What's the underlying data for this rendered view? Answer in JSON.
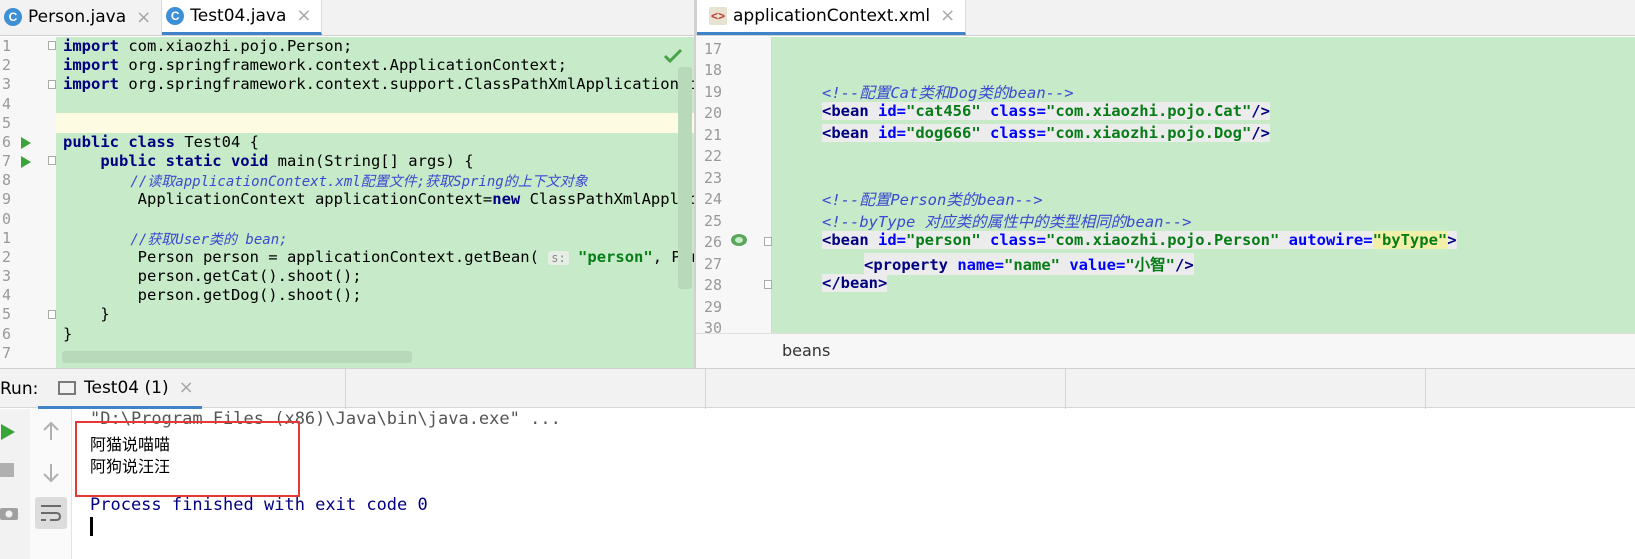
{
  "left_tabs": [
    {
      "label": "Person.java",
      "icon": "C",
      "active": false
    },
    {
      "label": "Test04.java",
      "icon": "C",
      "active": true
    }
  ],
  "right_tabs": [
    {
      "label": "applicationContext.xml",
      "icon": "xml",
      "active": true
    }
  ],
  "java_editor": {
    "line_numbers": [
      "1",
      "2",
      "3",
      "4",
      "5",
      "6",
      "7",
      "8",
      "9",
      "0",
      "1",
      "2",
      "3",
      "4",
      "5",
      "6",
      "7"
    ],
    "imports": [
      [
        "import",
        " com.xiaozhi.pojo.Person;"
      ],
      [
        "import",
        " org.springframework.context.ApplicationContext;"
      ],
      [
        "import",
        " org.springframework.context.support.ClassPathXmlApplicationContext"
      ]
    ],
    "class_kw1": "public",
    "class_kw2": " class",
    "class_rest": " Test04 {",
    "main_kw": "    public static void",
    "main_rest": " main(String[] args) {",
    "comment1": "        //读取applicationContext.xml配置文件;获取Spring的上下文对象",
    "line9a": "        ApplicationContext applicationContext=",
    "line9kw": "new",
    "line9b": " ClassPathXmlApplication",
    "comment2": "        //获取User类的 bean;",
    "line12a": "        Person person = applicationContext.getBean( ",
    "line12hint": "s:",
    "line12str": " \"person\"",
    "line12b": ", Person.cl",
    "line13": "        person.getCat().shoot();",
    "line14": "        person.getDog().shoot();",
    "line15": "    }",
    "line16": "}"
  },
  "xml_editor": {
    "line_numbers": [
      "17",
      "18",
      "19",
      "20",
      "21",
      "22",
      "23",
      "24",
      "25",
      "26",
      "27",
      "28",
      "29",
      "30"
    ],
    "comment1": "<!--配置Cat类和Dog类的bean-->",
    "bean_cat": {
      "tag": "<bean",
      "id_attr": " id=",
      "id_val": "\"cat456\"",
      "class_attr": " class=",
      "class_val": "\"com.xiaozhi.pojo.Cat\"",
      "end": "/>"
    },
    "bean_dog": {
      "tag": "<bean",
      "id_attr": " id=",
      "id_val": "\"dog666\"",
      "class_attr": " class=",
      "class_val": "\"com.xiaozhi.pojo.Dog\"",
      "end": "/>"
    },
    "comment2": "<!--配置Person类的bean-->",
    "comment3": "<!--byType 对应类的属性中的类型相同的bean-->",
    "bean_person": {
      "tag": "<bean",
      "id_attr": " id=",
      "id_val": "\"person\"",
      "class_attr": " class=",
      "class_val": "\"com.xiaozhi.pojo.Person\"",
      "autowire_attr": " autowire=",
      "autowire_val": "\"byType\"",
      "end": ">"
    },
    "property": {
      "tag": "<property",
      "name_attr": " name=",
      "name_val": "\"name\"",
      "value_attr": " value=",
      "value_val": "\"小智\"",
      "end": "/>"
    },
    "bean_close": "</bean>",
    "breadcrumb": "beans"
  },
  "run_panel": {
    "label": "Run:",
    "tab_label": "Test04 (1)",
    "console_lines": [
      "\"D:\\Program Files (x86)\\Java\\bin\\java.exe\" ...",
      "阿猫说喵喵",
      "阿狗说汪汪",
      "Process finished with exit code 0"
    ]
  },
  "colors": {
    "editor_bg": "#c7eac9",
    "tab_accent": "#4083c9",
    "highlight_box": "#e53935"
  }
}
